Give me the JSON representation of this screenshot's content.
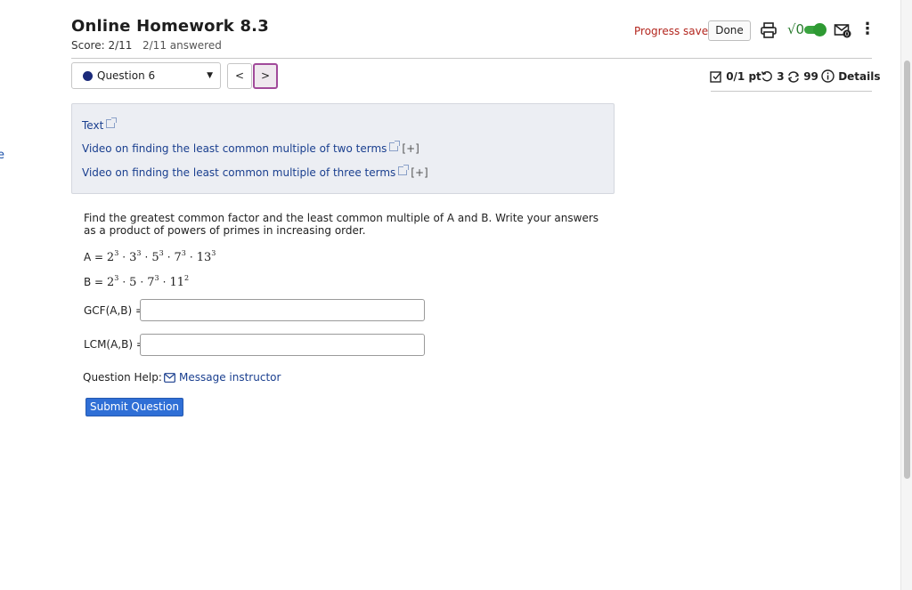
{
  "edge_fragment": "e",
  "header": {
    "title": "Online Homework 8.3",
    "score": "Score: 2/11",
    "answered": "2/11 answered",
    "progress_status": "Progress saved",
    "done_label": "Done",
    "sqrt_label": "√0",
    "mail_badge": "0"
  },
  "question_nav": {
    "selected": "Question 6",
    "prev": "<",
    "next": ">"
  },
  "meta": {
    "points": "0/1 pt",
    "retries": "3",
    "attempts": "99",
    "details": "Details"
  },
  "resources": {
    "text_link": "Text",
    "video1": "Video on finding the least common multiple of two terms",
    "video2": "Video on finding the least common multiple of three terms",
    "expand": "[+]"
  },
  "question": {
    "prompt": "Find the greatest common factor and the least common multiple of A and B.  Write your answers as a product of powers of primes in increasing order.",
    "a_label": "A =",
    "a_terms": [
      {
        "base": "2",
        "exp": "3"
      },
      {
        "base": "3",
        "exp": "3"
      },
      {
        "base": "5",
        "exp": "3"
      },
      {
        "base": "7",
        "exp": "3"
      },
      {
        "base": "13",
        "exp": "3"
      }
    ],
    "b_label": "B =",
    "b_terms": [
      {
        "base": "2",
        "exp": "3"
      },
      {
        "base": "5",
        "exp": ""
      },
      {
        "base": "7",
        "exp": "3"
      },
      {
        "base": "11",
        "exp": "2"
      }
    ],
    "gcf_label": "GCF(A,B) =",
    "gcf_value": "",
    "lcm_label": "LCM(A,B) =",
    "lcm_value": ""
  },
  "help": {
    "label": "Question Help:",
    "message_link": "Message instructor"
  },
  "submit_label": "Submit Question",
  "colors": {
    "accent_blue": "#2f6fd6",
    "link_blue": "#1a3f8f",
    "progress_red": "#b3261e",
    "toggle_green": "#3aa33f",
    "nav_highlight": "#a14a9a"
  }
}
